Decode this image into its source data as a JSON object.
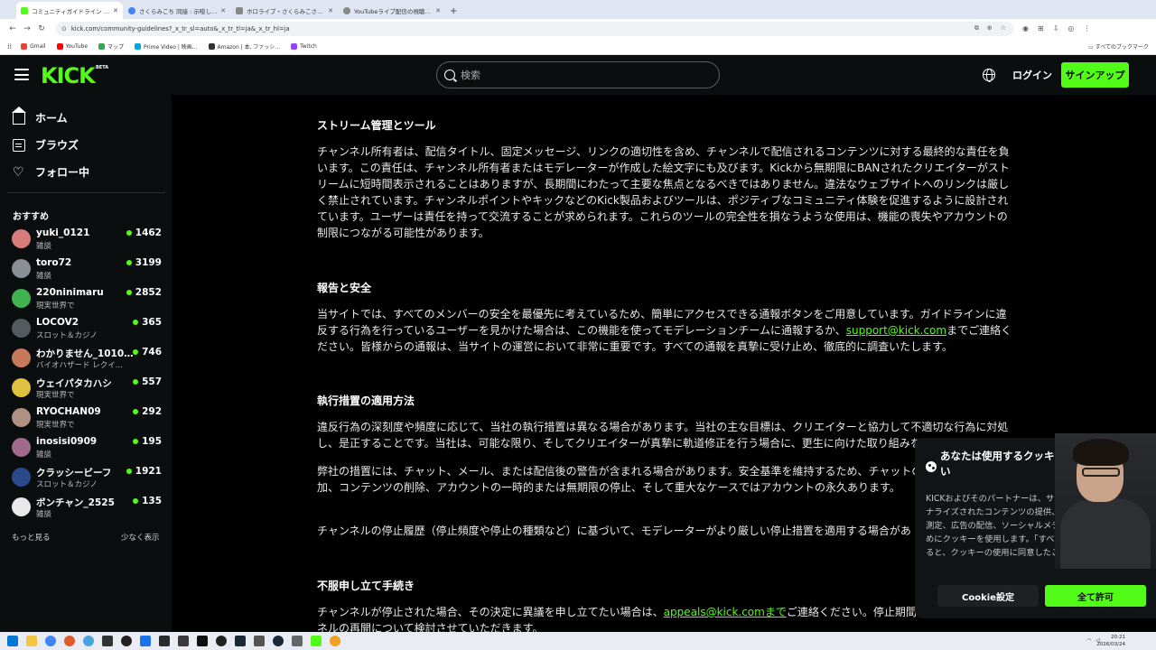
{
  "browser": {
    "tabs": [
      {
        "title": "コミュニティガイドライン - キック ストリ…",
        "active": true,
        "color": "#53fc18"
      },
      {
        "title": "さくらみこち 同接 : 示唆し - Google",
        "active": false,
        "color": "#4285f4"
      },
      {
        "title": "ホロライブ・さくらみこさん、配信の『…",
        "active": false,
        "color": "#888888"
      },
      {
        "title": "YouTubeライブ配信の視聴者数を…",
        "active": false,
        "color": "#888888"
      }
    ],
    "url": "kick.com/community-guidelines?_x_tr_sl=auto&_x_tr_tl=ja&_x_tr_hl=ja",
    "bookmarks": [
      "Gmail",
      "YouTube",
      "マップ",
      "Prime Video | 映画...",
      "Amazon | 本, ファッシ...",
      "Twitch"
    ],
    "bookmarks_right": "すべてのブックマーク"
  },
  "header": {
    "logo": "KICK",
    "beta": "BETA",
    "search_placeholder": "検索",
    "login": "ログイン",
    "signup": "サインアップ"
  },
  "sidebar": {
    "nav": [
      {
        "label": "ホーム",
        "icon": "home-icon"
      },
      {
        "label": "ブラウズ",
        "icon": "browse-icon"
      },
      {
        "label": "フォロー中",
        "icon": "heart-icon"
      }
    ],
    "recommended_title": "おすすめ",
    "channels": [
      {
        "name": "yuki_0121",
        "category": "雑談",
        "viewers": "1462",
        "color": "#d87b7b"
      },
      {
        "name": "toro72",
        "category": "雑談",
        "viewers": "3199",
        "color": "#8a8f96"
      },
      {
        "name": "220ninimaru",
        "category": "現実世界で",
        "viewers": "2852",
        "color": "#3fb34f"
      },
      {
        "name": "LOCOV2",
        "category": "スロット＆カジノ",
        "viewers": "365",
        "color": "#555a60"
      },
      {
        "name": "わかりません_10101...",
        "category": "バイオハザード レクイ...",
        "viewers": "746",
        "color": "#c77a5a"
      },
      {
        "name": "ウェイパタカハシ",
        "category": "現実世界で",
        "viewers": "557",
        "color": "#e0c040"
      },
      {
        "name": "RYOCHAN09",
        "category": "現実世界で",
        "viewers": "292",
        "color": "#b09080"
      },
      {
        "name": "inosisi0909",
        "category": "雑談",
        "viewers": "195",
        "color": "#a06a8a"
      },
      {
        "name": "クラッシービーフ",
        "category": "スロット＆カジノ",
        "viewers": "1921",
        "color": "#2a4a8a"
      },
      {
        "name": "ボンチャン_2525",
        "category": "雑談",
        "viewers": "135",
        "color": "#e8e8e8"
      }
    ],
    "show_more": "もっと見る",
    "show_less": "少なく表示"
  },
  "content": {
    "sections": [
      {
        "heading": "ストリーム管理とツール",
        "paragraphs": [
          "チャンネル所有者は、配信タイトル、固定メッセージ、リンクの適切性を含め、チャンネルで配信されるコンテンツに対する最終的な責任を負います。この責任は、チャンネル所有者またはモデレーターが作成した絵文字にも及びます。Kickから無期限にBANされたクリエイターがストリームに短時間表示されることはありますが、長期間にわたって主要な焦点となるべきではありません。違法なウェブサイトへのリンクは厳しく禁止されています。チャンネルポイントやキックなどのKick製品およびツールは、ポジティブなコミュニティ体験を促進するように設計されています。ユーザーは責任を持って交流することが求められます。これらのツールの完全性を損なうような使用は、機能の喪失やアカウントの制限につながる可能性があります。"
        ]
      },
      {
        "heading": "報告と安全",
        "para_before_link": "当サイトでは、すべてのメンバーの安全を最優先に考えているため、簡単にアクセスできる通報ボタンをご用意しています。ガイドラインに違反する行為を行っているユーザーを見かけた場合は、この機能を使ってモデレーションチームに通報するか、",
        "link": "support@kick.com",
        "para_after_link": "までご連絡ください。皆様からの通報は、当サイトの運営において非常に重要です。すべての通報を真摯に受け止め、徹底的に調査いたします。"
      },
      {
        "heading": "執行措置の適用方法",
        "paragraphs": [
          "違反行為の深刻度や頻度に応じて、当社の執行措置は異なる場合があります。当社の主な目標は、クリエイターと協力して不適切な行為に対処し、是正することです。当社は、可能な限り、そしてクリエイターが真摯に軌道修正を行う場合に、更生に向けた取り組みを",
          "弊社の措置には、チャット、メール、または配信後の警告が含まれる場合があります。安全基準を維持するため、チャットの剥奪、制限の追加、コンテンツの削除、アカウントの一時的または無期限の停止、そして重大なケースではアカウントの永久あります。",
          "チャンネルの停止履歴（停止頻度や停止の種類など）に基づいて、モデレーターがより厳しい停止措置を適用する場合があ"
        ]
      },
      {
        "heading": "不服申し立て手続き",
        "para_before_link": "チャンネルが停止された場合、その決定に異議を申し立てたい場合は、",
        "link": "appeals@kick.comまで",
        "para_after_link": "ご連絡ください。停止期間の",
        "para_line2": "ネルの再開について検討させていただきます。"
      }
    ]
  },
  "cookie": {
    "title": "あなたは使用するクッキーを選択してください",
    "body": "KICKおよびそのパートナーは、サービスの向上、パーソナライズされたコンテンツの提供、サイトの利用状況の測定、広告の配信、ソーシャルメディア機能の提供のためにクッキーを使用します。「すべて許可」をクリックすると、クッキーの使用に同意したことになります。",
    "settings": "Cookie設定",
    "accept_all": "全て許可"
  },
  "taskbar": {
    "time": "20:21",
    "date": "2026/03/24"
  },
  "colors": {
    "accent": "#53fc18",
    "bg": "#000000",
    "panel": "#0b0e0f"
  }
}
